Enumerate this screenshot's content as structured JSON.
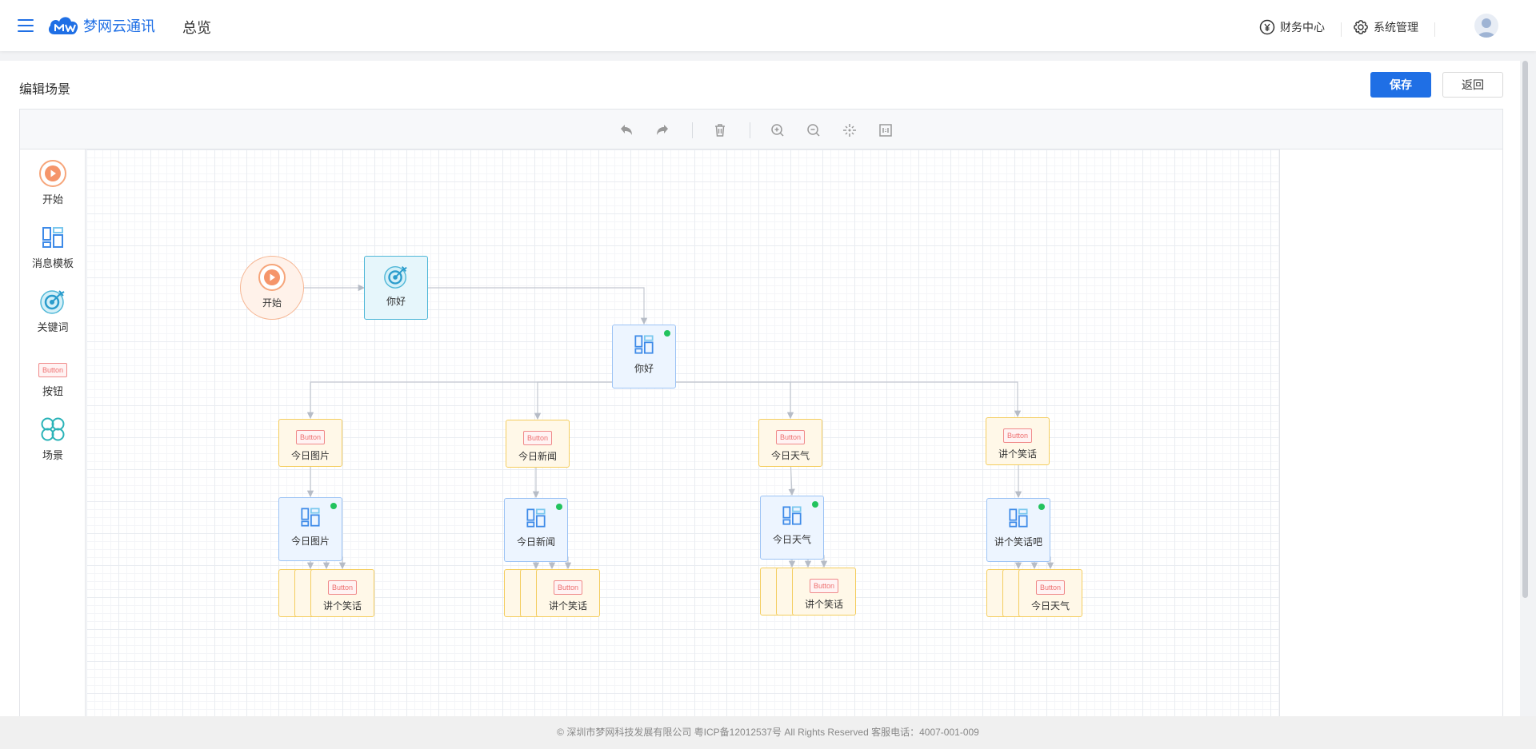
{
  "header": {
    "brand": "梦网云通讯",
    "overview": "总览",
    "finance": "财务中心",
    "system": "系统管理"
  },
  "page": {
    "title": "编辑场景",
    "save_label": "保存",
    "back_label": "返回"
  },
  "palette": [
    {
      "label": "开始",
      "icon": "play-circle-icon"
    },
    {
      "label": "消息模板",
      "icon": "layout-template-icon"
    },
    {
      "label": "关键词",
      "icon": "target-icon"
    },
    {
      "label": "按钮",
      "icon": "button-icon"
    },
    {
      "label": "场景",
      "icon": "clover-icon"
    }
  ],
  "toolbar": [
    "undo-icon",
    "redo-icon",
    "delete-icon",
    "zoom-in-icon",
    "zoom-out-icon",
    "fit-view-icon",
    "actual-size-icon"
  ],
  "button_tag": "Button",
  "nodes": {
    "start": "开始",
    "keyword": "你好",
    "root_msg": "你好",
    "buttons": [
      "今日图片",
      "今日新闻",
      "今日天气",
      "讲个笑话"
    ],
    "messages": [
      "今日图片",
      "今日新闻",
      "今日天气",
      "讲个笑话吧"
    ],
    "sub_buttons": [
      "讲个笑话",
      "讲个笑话",
      "讲个笑话",
      "今日天气"
    ]
  },
  "colors": {
    "primary": "#1f6fe5",
    "status_green": "#22c35e"
  },
  "footer": "© 深圳市梦网科技发展有限公司 粤ICP备12012537号 All Rights Reserved 客服电话：4007-001-009"
}
